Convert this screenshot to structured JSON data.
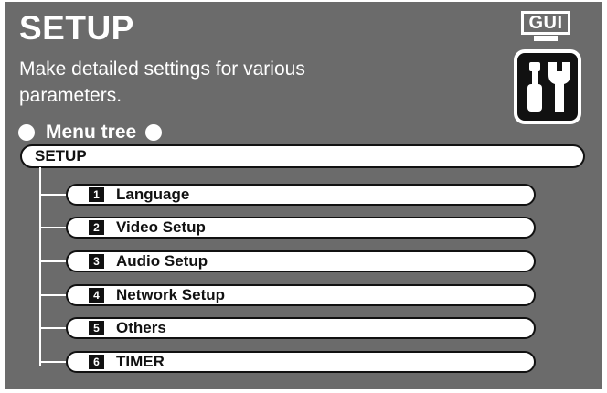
{
  "page": {
    "title": "SETUP",
    "description": "Make detailed settings for various parameters.",
    "gui_badge": "GUI",
    "icon": "tools-icon"
  },
  "menu_tree": {
    "heading": "Menu tree",
    "root": "SETUP",
    "items": [
      {
        "number": "1",
        "label": "Language"
      },
      {
        "number": "2",
        "label": "Video Setup"
      },
      {
        "number": "3",
        "label": "Audio Setup"
      },
      {
        "number": "4",
        "label": "Network Setup"
      },
      {
        "number": "5",
        "label": "Others"
      },
      {
        "number": "6",
        "label": "TIMER"
      }
    ]
  },
  "colors": {
    "panel": "#6b6b6b",
    "text_light": "#ffffff",
    "pill_fill": "#ffffff",
    "outline": "#111111"
  }
}
